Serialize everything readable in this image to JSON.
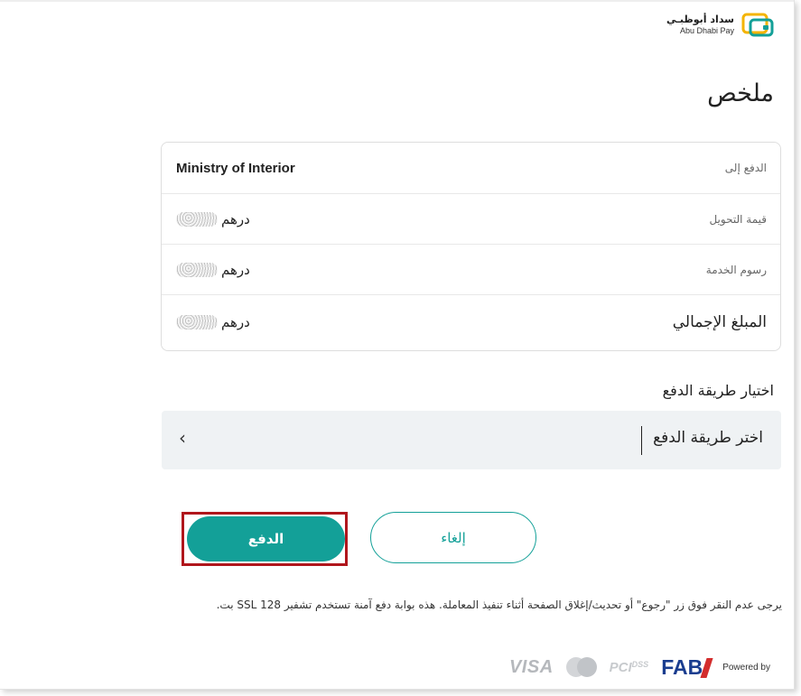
{
  "brand": {
    "name_ar": "سداد أبوظبـي",
    "name_en": "Abu Dhabi Pay",
    "accent": "#13a098",
    "logo_colors": [
      "#f4b400",
      "#13a098"
    ]
  },
  "page": {
    "title": "ملخص"
  },
  "summary": {
    "rows": [
      {
        "label": "الدفع إلى",
        "value": "Ministry of Interior"
      },
      {
        "label": "قيمة التحويل",
        "currency": "درهم"
      },
      {
        "label": "رسوم الخدمة",
        "currency": "درهم"
      },
      {
        "label": "المبلغ الإجمالي",
        "currency": "درهم"
      }
    ]
  },
  "payment_method": {
    "section_label": "اختيار طريقة الدفع",
    "placeholder": "اختر طريقة الدفع"
  },
  "actions": {
    "pay_label": "الدفع",
    "cancel_label": "إلغاء",
    "highlight_color": "#b0161c"
  },
  "notice": "يرجى عدم النقر فوق زر \"رجوع\" أو تحديث/إغلاق الصفحة أثناء تنفيذ المعاملة. هذه بوابة دفع آمنة تستخدم تشفير SSL 128 بت.",
  "footer": {
    "visa": "VISA",
    "pci": "PCI",
    "pci_sup": "DSS",
    "fab": "FAB",
    "powered_by": "Powered by"
  }
}
